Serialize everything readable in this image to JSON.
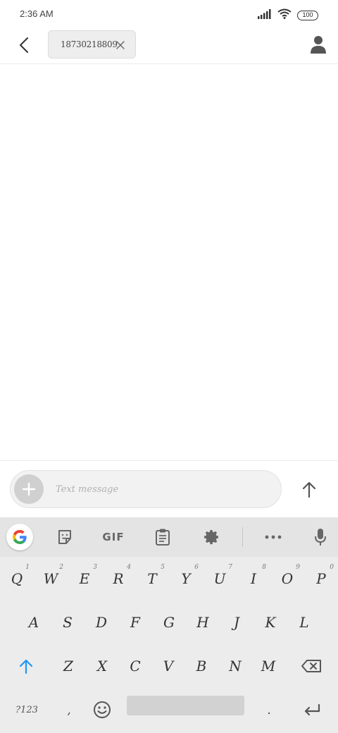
{
  "status_bar": {
    "time": "2:36 AM",
    "battery": "100"
  },
  "header": {
    "recipient": "18730218809"
  },
  "compose": {
    "placeholder": "Text message"
  },
  "keyboard": {
    "toolbar": {
      "gif_label": "GIF"
    },
    "rows": [
      [
        {
          "label": "Q",
          "hint": "1"
        },
        {
          "label": "W",
          "hint": "2"
        },
        {
          "label": "E",
          "hint": "3"
        },
        {
          "label": "R",
          "hint": "4"
        },
        {
          "label": "T",
          "hint": "5"
        },
        {
          "label": "Y",
          "hint": "6"
        },
        {
          "label": "U",
          "hint": "7"
        },
        {
          "label": "I",
          "hint": "8"
        },
        {
          "label": "O",
          "hint": "9"
        },
        {
          "label": "P",
          "hint": "0"
        }
      ],
      [
        {
          "label": "A"
        },
        {
          "label": "S"
        },
        {
          "label": "D"
        },
        {
          "label": "F"
        },
        {
          "label": "G"
        },
        {
          "label": "H"
        },
        {
          "label": "J"
        },
        {
          "label": "K"
        },
        {
          "label": "L"
        }
      ],
      [
        {
          "label": "Z"
        },
        {
          "label": "X"
        },
        {
          "label": "C"
        },
        {
          "label": "V"
        },
        {
          "label": "B"
        },
        {
          "label": "N"
        },
        {
          "label": "M"
        }
      ]
    ],
    "symbols_label": "?123",
    "comma_label": ",",
    "period_label": ".",
    "accent_color": "#2196f3"
  }
}
